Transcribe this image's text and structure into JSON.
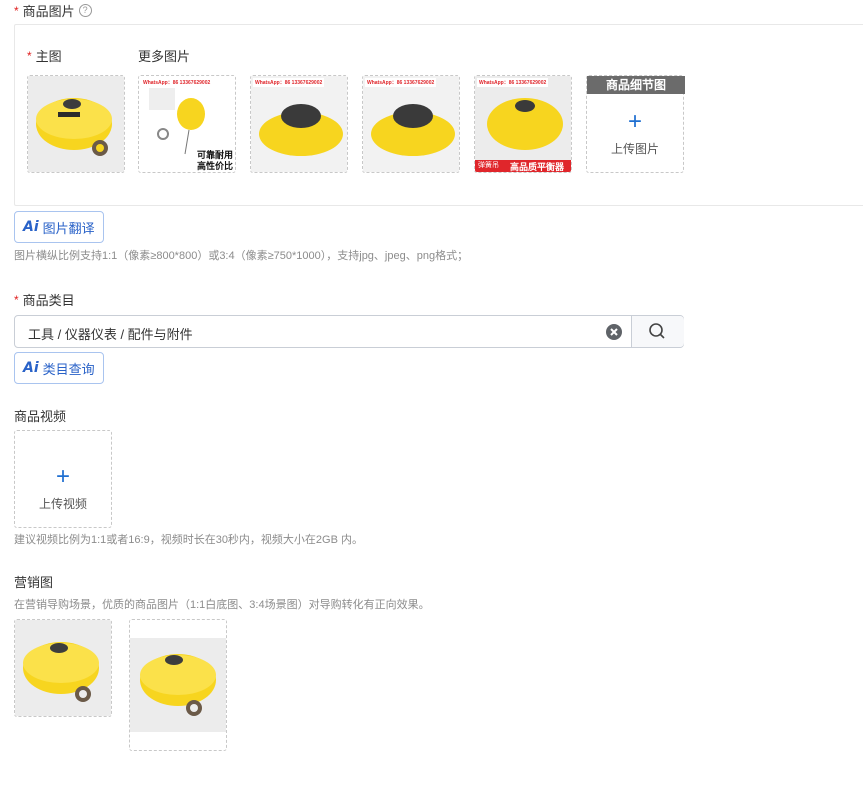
{
  "product_images": {
    "required_mark": "*",
    "title": "商品图片",
    "help_icon": "question-circle-icon",
    "main_label_required": "*",
    "main_label": "主图",
    "more_label": "更多图片",
    "thumbs": [
      {
        "watermark": "",
        "caption": ""
      },
      {
        "watermark": "WhatsApp：86 13367629002",
        "caption_line1": "可靠耐用",
        "caption_line2": "高性价比"
      },
      {
        "watermark": "WhatsApp：86 13367629002",
        "caption": ""
      },
      {
        "watermark": "WhatsApp：86 13367629002",
        "caption": ""
      },
      {
        "watermark": "WhatsApp：86 13367629002",
        "caption": "高品质平衡器",
        "corner": "弹簧吊"
      }
    ],
    "detail_banner": "商品细节图",
    "upload_plus": "+",
    "upload_label": "上传图片",
    "ai_button": "图片翻译",
    "ai_mark": "Ai",
    "hint": "图片横纵比例支持1:1（像素≥800*800）或3:4（像素≥750*1000），支持jpg、jpeg、png格式；"
  },
  "category": {
    "required_mark": "*",
    "title": "商品类目",
    "value": "工具 / 仪器仪表 / 配件与附件",
    "ai_button": "类目查询",
    "ai_mark": "Ai"
  },
  "video": {
    "title": "商品视频",
    "upload_plus": "+",
    "upload_label": "上传视频",
    "hint": "建议视频比例为1:1或者16:9，视频时长在30秒内，视频大小在2GB 内。"
  },
  "marketing": {
    "title": "营销图",
    "hint": "在营销导购场景，优质的商品图片（1:1白底图、3:4场景图）对导购转化有正向效果。"
  },
  "colors": {
    "accent": "#2962c8",
    "required": "#e02020",
    "product_yellow": "#f7d51f"
  }
}
